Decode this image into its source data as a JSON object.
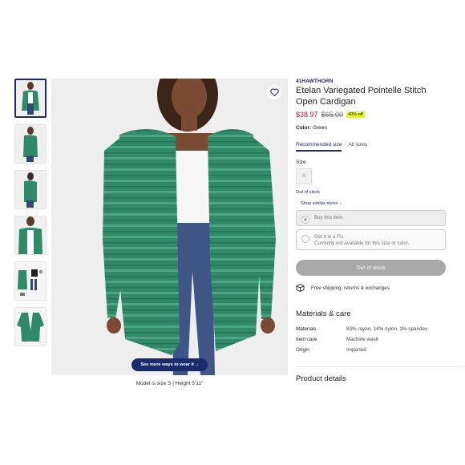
{
  "product": {
    "brand": "41HAWTHORN",
    "title": "Etelan Variegated Pointelle Stitch Open Cardigan",
    "price_now": "$38.97",
    "price_was": "$65.00",
    "discount_badge": "40% off",
    "color_label": "Color:",
    "color_value": "Green"
  },
  "gallery": {
    "thumbnail_count": 6,
    "wear_button_label": "See more ways to wear it",
    "caption": "Model is size S | Height 5'11\""
  },
  "size_tabs": [
    "Recommended size",
    "All sizes"
  ],
  "size": {
    "label": "Size",
    "options": [
      "S"
    ],
    "out_of_stock_text": "Out of stock",
    "similar_link": "Shop similar styles"
  },
  "purchase_options": {
    "buy_label": "Buy this item",
    "fix_label": "Get it in a Fix",
    "fix_note": "Currently not available for this size or color."
  },
  "cta_label": "Out of stock",
  "shipping_text": "Free shipping, returns & exchanges",
  "materials": {
    "heading": "Materials & care",
    "rows": [
      {
        "key": "Materials",
        "value": "83% rayon, 14% nylon, 3% spandex"
      },
      {
        "key": "Item care",
        "value": "Machine wash"
      },
      {
        "key": "Origin",
        "value": "Imported"
      }
    ]
  },
  "product_details_heading": "Product details",
  "colors": {
    "brand_navy": "#1b2a6b",
    "sale_red": "#c8102e",
    "badge_yellow": "#e7f238",
    "cardigan_green": "#2f8a68"
  }
}
